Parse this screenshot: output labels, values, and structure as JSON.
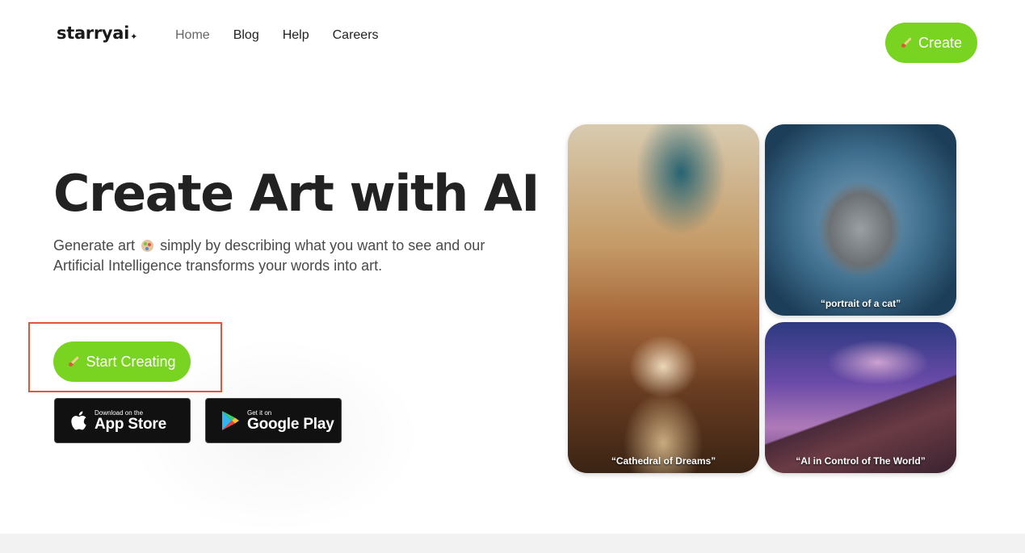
{
  "header": {
    "logo": "starryai",
    "logo_spark": "✦",
    "nav": [
      "Home",
      "Blog",
      "Help",
      "Careers"
    ],
    "create_label": "Create"
  },
  "hero": {
    "title": "Create Art with AI",
    "subtitle_part1": "Generate art",
    "subtitle_part2": "simply by describing what you want to see and our Artificial Intelligence transforms your words into art.",
    "start_label": "Start Creating"
  },
  "stores": {
    "appstore_small": "Download on the",
    "appstore_big": "App Store",
    "gplay_small": "Get it on",
    "gplay_big": "Google Play"
  },
  "gallery": {
    "cathedral_caption": "“Cathedral of Dreams”",
    "cat_caption": "“portrait of a cat”",
    "space_caption": "“AI in Control of The World”"
  },
  "colors": {
    "accent_green": "#79d321",
    "highlight_red": "#e0553b"
  }
}
